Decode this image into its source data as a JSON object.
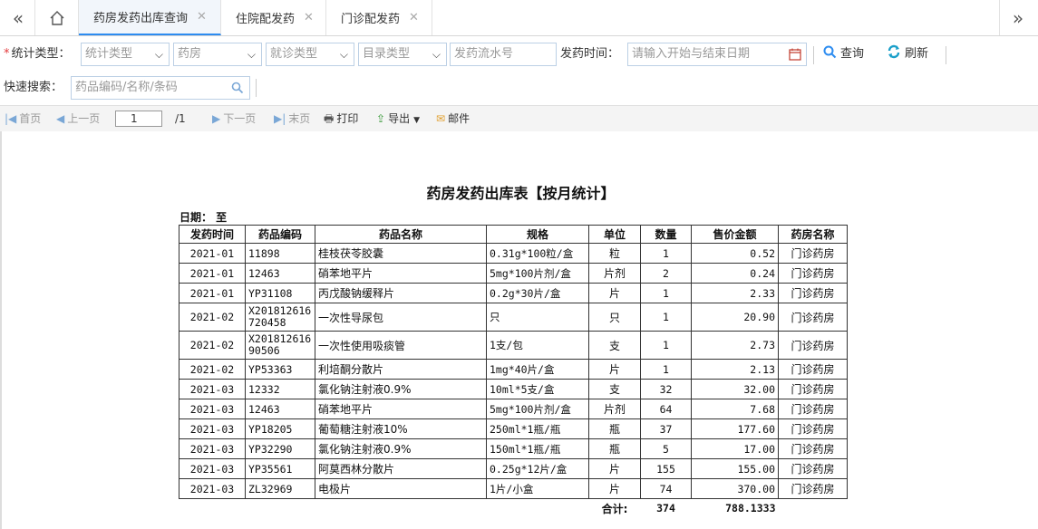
{
  "tabs": [
    {
      "label": "药房发药出库查询",
      "active": true
    },
    {
      "label": "住院配发药",
      "active": false
    },
    {
      "label": "门诊配发药",
      "active": false
    }
  ],
  "filters": {
    "stat_type_label": "统计类型：",
    "stat_type_placeholder": "统计类型",
    "pharmacy_placeholder": "药房",
    "visit_type_placeholder": "就诊类型",
    "catalog_type_placeholder": "目录类型",
    "serial_placeholder": "发药流水号",
    "time_label": "发药时间：",
    "time_placeholder": "请输入开始与结束日期",
    "query_label": "查询",
    "refresh_label": "刷新",
    "quick_label": "快速搜索：",
    "quick_placeholder": "药品编码/名称/条码"
  },
  "report_toolbar": {
    "first": "首页",
    "prev": "上一页",
    "page": "1",
    "total_pages": "/1",
    "next": "下一页",
    "last": "末页",
    "print": "打印",
    "export": "导出",
    "mail": "邮件"
  },
  "report": {
    "title": "药房发药出库表【按月统计】",
    "date_label": "日期：  至",
    "columns": [
      "发药时间",
      "药品编码",
      "药品名称",
      "规格",
      "单位",
      "数量",
      "售价金额",
      "药房名称"
    ],
    "rows": [
      {
        "month": "2021-01",
        "code": "11898",
        "name": "桂枝茯苓胶囊",
        "spec": "0.31g*100粒/盒",
        "unit": "粒",
        "qty": "1",
        "amount": "0.52",
        "pharmacy": "门诊药房"
      },
      {
        "month": "2021-01",
        "code": "12463",
        "name": "硝苯地平片",
        "spec": "5mg*100片剂/盒",
        "unit": "片剂",
        "qty": "2",
        "amount": "0.24",
        "pharmacy": "门诊药房"
      },
      {
        "month": "2021-01",
        "code": "YP31108",
        "name": "丙戊酸钠缓释片",
        "spec": "0.2g*30片/盒",
        "unit": "片",
        "qty": "1",
        "amount": "2.33",
        "pharmacy": "门诊药房"
      },
      {
        "month": "2021-02",
        "code": "X201812616720458",
        "name": "一次性导尿包",
        "spec": "只",
        "unit": "只",
        "qty": "1",
        "amount": "20.90",
        "pharmacy": "门诊药房"
      },
      {
        "month": "2021-02",
        "code": "X20181261690506",
        "name": "一次性使用吸痰管",
        "spec": "1支/包",
        "unit": "支",
        "qty": "1",
        "amount": "2.73",
        "pharmacy": "门诊药房"
      },
      {
        "month": "2021-02",
        "code": "YP53363",
        "name": "利培酮分散片",
        "spec": "1mg*40片/盒",
        "unit": "片",
        "qty": "1",
        "amount": "2.13",
        "pharmacy": "门诊药房"
      },
      {
        "month": "2021-03",
        "code": "12332",
        "name": "氯化钠注射液0.9%",
        "spec": "10ml*5支/盒",
        "unit": "支",
        "qty": "32",
        "amount": "32.00",
        "pharmacy": "门诊药房"
      },
      {
        "month": "2021-03",
        "code": "12463",
        "name": "硝苯地平片",
        "spec": "5mg*100片剂/盒",
        "unit": "片剂",
        "qty": "64",
        "amount": "7.68",
        "pharmacy": "门诊药房"
      },
      {
        "month": "2021-03",
        "code": "YP18205",
        "name": "葡萄糖注射液10%",
        "spec": "250ml*1瓶/瓶",
        "unit": "瓶",
        "qty": "37",
        "amount": "177.60",
        "pharmacy": "门诊药房"
      },
      {
        "month": "2021-03",
        "code": "YP32290",
        "name": "氯化钠注射液0.9%",
        "spec": "150ml*1瓶/瓶",
        "unit": "瓶",
        "qty": "5",
        "amount": "17.00",
        "pharmacy": "门诊药房"
      },
      {
        "month": "2021-03",
        "code": "YP35561",
        "name": "阿莫西林分散片",
        "spec": "0.25g*12片/盒",
        "unit": "片",
        "qty": "155",
        "amount": "155.00",
        "pharmacy": "门诊药房"
      },
      {
        "month": "2021-03",
        "code": "ZL32969",
        "name": "电极片",
        "spec": "1片/小盒",
        "unit": "片",
        "qty": "74",
        "amount": "370.00",
        "pharmacy": "门诊药房"
      }
    ],
    "total_label": "合计:",
    "total_qty": "374",
    "total_amount": "788.1333"
  },
  "colors": {
    "accent": "#2d8cf0",
    "required": "#e4393c",
    "border": "#bcd0e5"
  }
}
